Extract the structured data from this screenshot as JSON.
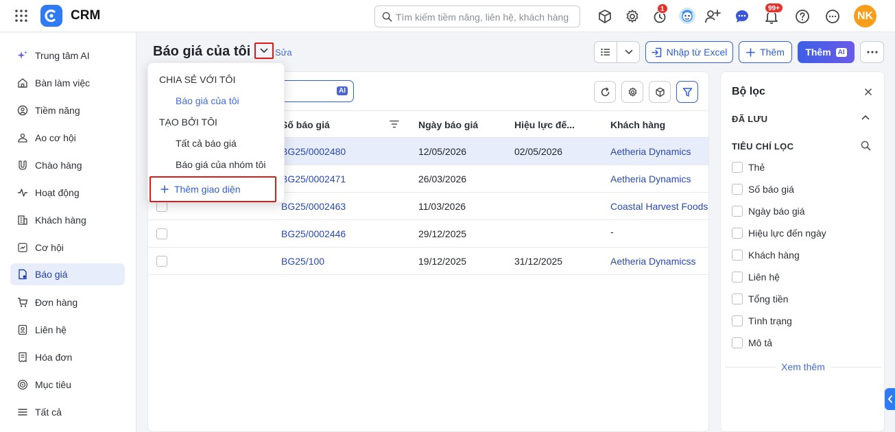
{
  "app": {
    "title": "CRM"
  },
  "search": {
    "placeholder": "Tìm kiếm tiềm năng, liên hệ, khách hàng"
  },
  "topbar": {
    "timer_badge": "1",
    "notifications_badge": "99+",
    "user_initials": "NK"
  },
  "sidebar": {
    "items": [
      {
        "label": "Trung tâm AI",
        "icon": "sparkle-icon"
      },
      {
        "label": "Bàn làm việc",
        "icon": "home-icon"
      },
      {
        "label": "Tiềm năng",
        "icon": "target-user-icon"
      },
      {
        "label": "Ao cơ hội",
        "icon": "pond-icon"
      },
      {
        "label": "Chào hàng",
        "icon": "magnet-icon"
      },
      {
        "label": "Hoạt động",
        "icon": "activity-icon"
      },
      {
        "label": "Khách hàng",
        "icon": "building-icon"
      },
      {
        "label": "Cơ hội",
        "icon": "opportunity-icon"
      },
      {
        "label": "Báo giá",
        "icon": "quote-icon",
        "active": true
      },
      {
        "label": "Đơn hàng",
        "icon": "cart-icon"
      },
      {
        "label": "Liên hệ",
        "icon": "contact-icon"
      },
      {
        "label": "Hóa đơn",
        "icon": "invoice-icon"
      },
      {
        "label": "Mục tiêu",
        "icon": "goal-icon"
      },
      {
        "label": "Tất cả",
        "icon": "menu-icon"
      }
    ]
  },
  "header": {
    "title": "Báo giá của tôi",
    "edit_label": "Sửa",
    "import_label": "Nhập từ Excel",
    "add_label": "Thêm",
    "ai_add_label": "Thêm",
    "ai_tag": "AI"
  },
  "dropdown": {
    "shared_heading": "CHIA SẺ VỚI TÔI",
    "shared_items": [
      "Báo giá của tôi"
    ],
    "created_heading": "TẠO BỞI TÔI",
    "created_items": [
      "Tất cả báo giá",
      "Báo giá của nhóm tôi"
    ],
    "add_view_label": "Thêm giao diện"
  },
  "table": {
    "search_ai_tag": "AI",
    "columns": [
      "Số báo giá",
      "Ngày báo giá",
      "Hiệu lực đế...",
      "Khách hàng"
    ],
    "rows": [
      {
        "number": "BG25/0002480",
        "date": "12/05/2026",
        "valid_until": "02/05/2026",
        "customer": "Aetheria Dynamics",
        "selected": true
      },
      {
        "number": "BG25/0002471",
        "date": "26/03/2026",
        "valid_until": "",
        "customer": "Aetheria Dynamics"
      },
      {
        "number": "BG25/0002463",
        "date": "11/03/2026",
        "valid_until": "",
        "customer": "Coastal Harvest Foods"
      },
      {
        "number": "BG25/0002446",
        "date": "29/12/2025",
        "valid_until": "",
        "customer": "-"
      },
      {
        "number": "BG25/100",
        "date": "19/12/2025",
        "valid_until": "31/12/2025",
        "customer": "Aetheria Dynamicss"
      }
    ]
  },
  "filter": {
    "title": "Bộ lọc",
    "saved_heading": "ĐÃ LƯU",
    "criteria_heading": "TIÊU CHÍ LỌC",
    "items": [
      "Thẻ",
      "Số báo giá",
      "Ngày báo giá",
      "Hiệu lực đến ngày",
      "Khách hàng",
      "Liên hệ",
      "Tổng tiền",
      "Tình trạng",
      "Mô tả"
    ],
    "more_label": "Xem thêm"
  },
  "colors": {
    "accent": "#2f5fd4",
    "highlight_box": "#e01818",
    "active_nav_bg": "#e8edfb",
    "badge": "#e7312d",
    "avatar": "#f79e1b"
  }
}
